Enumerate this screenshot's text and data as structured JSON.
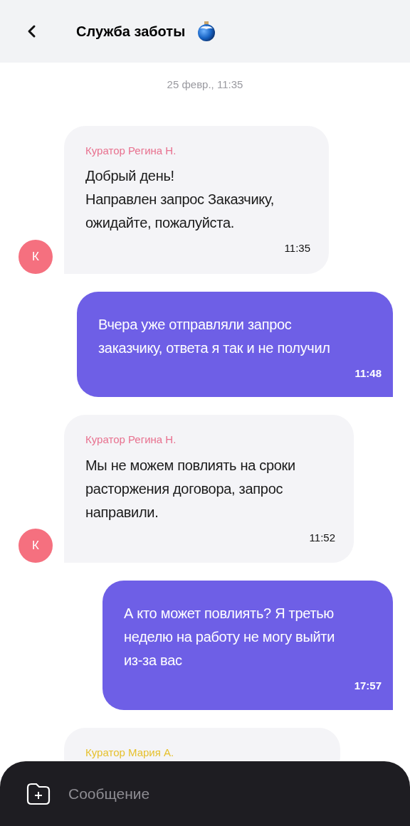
{
  "header": {
    "title": "Служба заботы"
  },
  "date": "25 февр., 11:35",
  "messages": [
    {
      "kind": "incoming",
      "sender": "Куратор Регина Н.",
      "color": "#e8718f",
      "avatar": "К",
      "text": "Добрый день!\nНаправлен запрос Заказчику, ожидайте, пожалуйста.",
      "time": "11:35"
    },
    {
      "kind": "outgoing",
      "text": "Вчера уже отправляли запрос заказчику, ответа я так и не получил",
      "time": "11:48"
    },
    {
      "kind": "incoming",
      "sender": "Куратор Регина Н.",
      "color": "#e8718f",
      "avatar": "К",
      "text": "Мы не можем повлиять на сроки расторжения договора, запрос направили.",
      "time": "11:52"
    },
    {
      "kind": "outgoing",
      "text": "А кто может повлиять? Я третью неделю на работу не могу выйти из-за вас",
      "time": "17:57"
    },
    {
      "kind": "incoming",
      "sender": "Куратор Мария А.",
      "color": "#e6c12e"
    }
  ],
  "composer": {
    "placeholder": "Сообщение"
  }
}
